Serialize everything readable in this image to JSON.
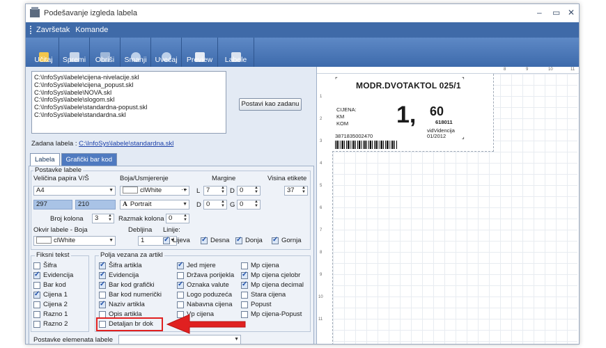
{
  "window": {
    "title": "Podešavanje izgleda labela"
  },
  "menu": {
    "items": [
      "Završetak",
      "Komande"
    ]
  },
  "toolbar": {
    "buttons": [
      {
        "label": "Učitaj",
        "icon": "folder-icon"
      },
      {
        "label": "Spremi",
        "icon": "save-icon"
      },
      {
        "label": "Obriši",
        "icon": "delete-icon"
      },
      {
        "label": "Smanji",
        "icon": "zoom-out-icon"
      },
      {
        "label": "Uvećaj",
        "icon": "zoom-in-icon"
      },
      {
        "label": "Preview",
        "icon": "preview-icon"
      },
      {
        "label": "Labele",
        "icon": "labels-icon"
      }
    ]
  },
  "files": [
    "C:\\InfoSys\\labele\\cijena-nivelacije.skl",
    "C:\\InfoSys\\labele\\cijena_popust.skl",
    "C:\\InfoSys\\labele\\NOVA.skl",
    "C:\\InfoSys\\labele\\slogom.skl",
    "C:\\InfoSys\\labele\\standardna-popust.skl",
    "C:\\InfoSys\\labele\\standardna.skl"
  ],
  "set_default_label": "Postavi kao zadanu",
  "default_label": {
    "caption": "Zadana labela :",
    "path": "C:\\InfoSys\\labele\\standardna.skl"
  },
  "tabs": [
    "Labela",
    "Grafički bar kod"
  ],
  "settings": {
    "group_title": "Postavke labele",
    "paper_size_label": "Veličina papira V/Š",
    "paper_size_value": "A4",
    "paper_h": "297",
    "paper_w": "210",
    "color_label": "Boja/Usmjerenje",
    "color_value": "clWhite",
    "orientation_value": "Portrait",
    "orientation_glyph": "A",
    "margins_label": "Margine",
    "margin_L_label": "L",
    "margin_L": "7",
    "margin_D_label": "D",
    "margin_D": "0",
    "margin_D2_label": "D",
    "margin_D2": "0",
    "margin_G_label": "G",
    "margin_G": "0",
    "height_label": "Visina etikete",
    "height_value": "37",
    "columns_label": "Broj kolona",
    "columns_value": "3",
    "col_spacing_label": "Razmak kolona",
    "col_spacing_value": "0",
    "frame_label": "Okvir labele  -  Boja",
    "frame_color": "clWhite",
    "thickness_label": "Debljina",
    "thickness_value": "1",
    "lines_label": "Linije:",
    "lines": [
      {
        "label": "Lijeva",
        "checked": true
      },
      {
        "label": "Desna",
        "checked": true
      },
      {
        "label": "Donja",
        "checked": true
      },
      {
        "label": "Gornja",
        "checked": true
      }
    ]
  },
  "fixed_text": {
    "title": "Fiksni tekst",
    "items": [
      {
        "label": "Šifra",
        "checked": false
      },
      {
        "label": "Evidencija",
        "checked": true
      },
      {
        "label": "Bar kod",
        "checked": false
      },
      {
        "label": "Cijena 1",
        "checked": true
      },
      {
        "label": "Cijena 2",
        "checked": false
      },
      {
        "label": "Razno 1",
        "checked": false
      },
      {
        "label": "Razno 2",
        "checked": false
      }
    ]
  },
  "article_fields": {
    "title": "Polja vezana za artikl",
    "col1": [
      {
        "label": "Šifra artikla",
        "checked": true
      },
      {
        "label": "Evidencija",
        "checked": true
      },
      {
        "label": "Bar kod grafički",
        "checked": true
      },
      {
        "label": "Bar kod numerički",
        "checked": false
      },
      {
        "label": "Naziv artikla",
        "checked": true
      },
      {
        "label": "Opis artikla",
        "checked": false
      },
      {
        "label": "Detaljan br dok",
        "checked": false
      }
    ],
    "col2": [
      {
        "label": "Jed mjere",
        "checked": true
      },
      {
        "label": "Država porijekla",
        "checked": false
      },
      {
        "label": "Oznaka valute",
        "checked": true
      },
      {
        "label": "Logo poduzeća",
        "checked": false
      },
      {
        "label": "Nabavna cijena",
        "checked": false
      },
      {
        "label": "Vp cijena",
        "checked": false
      }
    ],
    "col3": [
      {
        "label": "Mp cijena",
        "checked": false
      },
      {
        "label": "Mp cijena cjelobr",
        "checked": true
      },
      {
        "label": "Mp cijena decimal",
        "checked": true
      },
      {
        "label": "Stara cijena",
        "checked": false
      },
      {
        "label": "Popust",
        "checked": false
      },
      {
        "label": "Mp cijena-Popust",
        "checked": false
      }
    ]
  },
  "elements_label": "Postavke elemenata labele",
  "ruler": {
    "top": [
      "8",
      "9",
      "10",
      "11"
    ],
    "left": [
      "1",
      "2",
      "3",
      "4",
      "5",
      "6",
      "7",
      "8",
      "9",
      "10",
      "11"
    ]
  },
  "preview": {
    "title": "MODR.DVOTAKTOL 025/1",
    "price_caption": "CIJENA:",
    "unit_1": "KM",
    "unit_2": "KOM",
    "price_int": "1,",
    "price_dec": "60",
    "code": "618011",
    "barcode_number": "3871835002470",
    "evid": "vidVidencija",
    "date": "01/2012"
  },
  "colors": {
    "menubar": "#3f6aa8",
    "toolbar": "#4a76b6",
    "highlight": "#e02020"
  }
}
